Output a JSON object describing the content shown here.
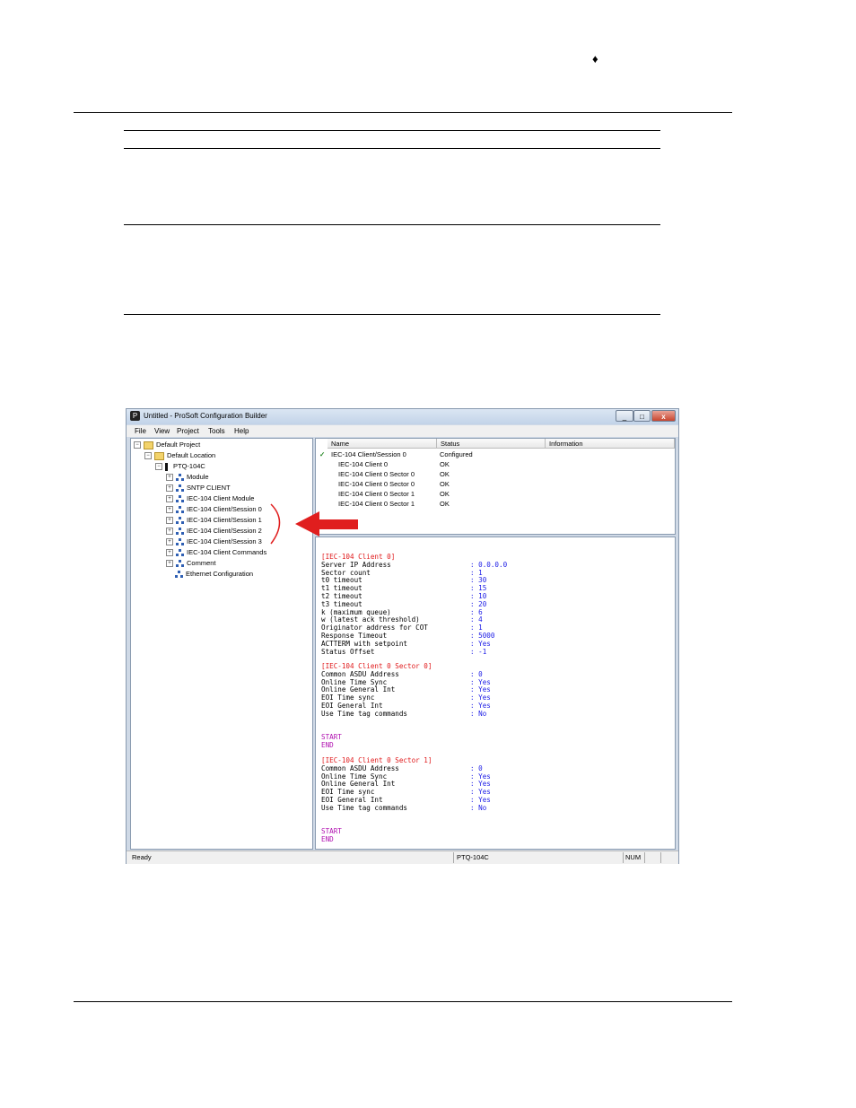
{
  "page": {
    "marker": "♦"
  },
  "window": {
    "title": "Untitled - ProSoft Configuration Builder",
    "minimize": "_",
    "maximize": "□",
    "close": "x",
    "menu": [
      "File",
      "View",
      "Project",
      "Tools",
      "Help"
    ]
  },
  "tree": [
    {
      "label": "Default Project",
      "expander": "−",
      "icon": "folder-icon"
    },
    {
      "label": "Default Location",
      "expander": "−",
      "icon": "folder-icon"
    },
    {
      "label": "PTQ-104C",
      "expander": "−",
      "icon": "device-icon"
    },
    {
      "label": "Module",
      "expander": "+",
      "icon": "network-icon"
    },
    {
      "label": "SNTP CLIENT",
      "expander": "+",
      "icon": "network-icon"
    },
    {
      "label": "IEC-104 Client Module",
      "expander": "+",
      "icon": "network-icon"
    },
    {
      "label": "IEC-104 Client/Session 0",
      "expander": "+",
      "icon": "network-icon"
    },
    {
      "label": "IEC-104 Client/Session 1",
      "expander": "+",
      "icon": "network-icon"
    },
    {
      "label": "IEC-104 Client/Session 2",
      "expander": "+",
      "icon": "network-icon"
    },
    {
      "label": "IEC-104 Client/Session 3",
      "expander": "+",
      "icon": "network-icon"
    },
    {
      "label": "IEC-104 Client Commands",
      "expander": "+",
      "icon": "network-icon"
    },
    {
      "label": "Comment",
      "expander": "+",
      "icon": "network-icon"
    },
    {
      "label": "Ethernet Configuration",
      "expander": "",
      "icon": "network-icon"
    }
  ],
  "list": {
    "headers": [
      "Name",
      "Status",
      "Information"
    ],
    "check": "✓",
    "rows": [
      {
        "name": "IEC-104 Client/Session 0",
        "status": "Configured",
        "info": ""
      },
      {
        "name": "IEC-104 Client 0",
        "status": "OK",
        "info": ""
      },
      {
        "name": "IEC-104 Client 0 Sector 0",
        "status": "OK",
        "info": ""
      },
      {
        "name": "IEC-104 Client 0 Sector 0",
        "status": "OK",
        "info": ""
      },
      {
        "name": "IEC-104 Client 0 Sector 1",
        "status": "OK",
        "info": ""
      },
      {
        "name": "IEC-104 Client 0 Sector 1",
        "status": "OK",
        "info": ""
      }
    ]
  },
  "config": {
    "client_header": "[IEC-104 Client 0]",
    "client_params": [
      {
        "k": "Server IP Address",
        "v": ": 0.0.0.0"
      },
      {
        "k": "Sector count",
        "v": ": 1"
      },
      {
        "k": "t0 timeout",
        "v": ": 30"
      },
      {
        "k": "t1 timeout",
        "v": ": 15"
      },
      {
        "k": "t2 timeout",
        "v": ": 10"
      },
      {
        "k": "t3 timeout",
        "v": ": 20"
      },
      {
        "k": "k (maximum queue)",
        "v": ": 6"
      },
      {
        "k": "w (latest ack threshold)",
        "v": ": 4"
      },
      {
        "k": "Originator address for COT",
        "v": ": 1"
      },
      {
        "k": "Response Timeout",
        "v": ": 5000"
      },
      {
        "k": "ACTTERM with setpoint",
        "v": ": Yes"
      },
      {
        "k": "Status Offset",
        "v": ": -1"
      }
    ],
    "sector0_header": "[IEC-104 Client 0 Sector 0]",
    "sector0_params": [
      {
        "k": "Common ASDU Address",
        "v": ": 0"
      },
      {
        "k": "Online Time Sync",
        "v": ": Yes"
      },
      {
        "k": "Online General Int",
        "v": ": Yes"
      },
      {
        "k": "EOI Time sync",
        "v": ": Yes"
      },
      {
        "k": "EOI General Int",
        "v": ": Yes"
      },
      {
        "k": "Use Time tag commands",
        "v": ": No"
      }
    ],
    "sector1_header": "[IEC-104 Client 0 Sector 1]",
    "sector1_params": [
      {
        "k": "Common ASDU Address",
        "v": ": 0"
      },
      {
        "k": "Online Time Sync",
        "v": ": Yes"
      },
      {
        "k": "Online General Int",
        "v": ": Yes"
      },
      {
        "k": "EOI Time sync",
        "v": ": Yes"
      },
      {
        "k": "EOI General Int",
        "v": ": Yes"
      },
      {
        "k": "Use Time tag commands",
        "v": ": No"
      }
    ],
    "start": "START",
    "end": "END"
  },
  "status": {
    "left": "Ready",
    "device": "PTQ-104C",
    "num": "NUM"
  },
  "colors": {
    "section": "#e0191b",
    "value": "#1a1ae6",
    "keyword": "#b010b0",
    "arrow": "#e01e1e"
  }
}
